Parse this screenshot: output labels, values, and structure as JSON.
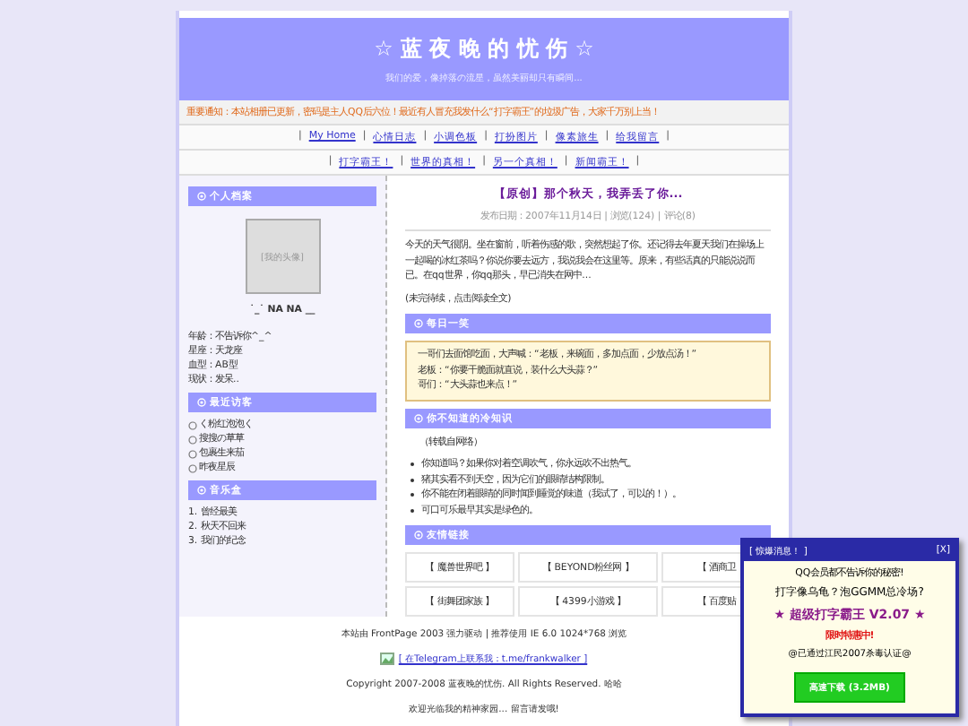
{
  "header": {
    "title": "☆ 蓝 夜 晚 的 忧 伤 ☆",
    "subtitle": "我们的爱，像掉落の流星，虽然美丽却只有瞬间..."
  },
  "notice": "重要通知：本站相册已更新，密码是主人QQ后六位！最近有人冒充我发什么“打字霸王”的垃圾广告，大家千万别上当！",
  "nav_separator": "|",
  "nav_rows": [
    [
      "My Home",
      "心情日志",
      "小调色板",
      "打扮图片",
      "像素旅生",
      "给我留言"
    ],
    [
      "打字霸王！",
      "世界的真相！",
      "另一个真相！",
      "新闻霸王！"
    ]
  ],
  "sidebar": {
    "profile": {
      "heading": "个人档案",
      "avatar": "[我的头像]",
      "nickname": "˙_˙ NA NA __",
      "facts": [
        "年龄：不告诉你^_^",
        "星座：天龙座",
        "血型：AB型",
        "现状：发呆.."
      ]
    },
    "visitors": {
      "heading": "最近访客",
      "items": [
        "く粉红泡泡く",
        "搜搜の草草",
        "包裹生来茄",
        "昨夜星辰"
      ]
    },
    "music": {
      "heading": "音乐盒",
      "items": [
        "1. 曾经最美",
        "2. 秋天不回来",
        "3. 我们的纪念"
      ]
    }
  },
  "post": {
    "title": "【原创】那个秋天，我弄丢了你...",
    "meta": "发布日期：2007年11月14日 | 浏览(124) | 评论(8)",
    "body": "今天的天气很阴。坐在窗前，听着伤感的歌，突然想起了你。还记得去年夏天我们在操场上一起喝的冰红茶吗？你说你要去远方，我说我会在这里等。原来，有些话真的只能说说而已。在qq世界，你qq那头，早已消失在网中...",
    "more": "(未完待续，点击阅读全文)"
  },
  "joke": {
    "heading": "每日一笑",
    "lines": [
      "一哥们去面馆吃面，大声喊：“老板，来碗面，多加点面，少放点汤！”",
      "老板：“你要干脆面就直说，装什么大头蒜？”",
      "哥们：“大头蒜也来点！”"
    ]
  },
  "facts": {
    "heading": "你不知道的冷知识",
    "source": "（转载自网络）",
    "items": [
      "你知道吗？如果你对着空调吹气，你永远吹不出热气。",
      "猪其实看不到天空，因为它们的眼睛结构限制。",
      "你不能在闭着眼睛的同时闻到睡觉的味道（我试了，可以的！）。",
      "可口可乐最早其实是绿色的。"
    ]
  },
  "links": {
    "heading": "友情链接",
    "cells": [
      "【 魔兽世界吧 】",
      "【 BEYOND粉丝网 】",
      "【 酒商卫",
      "【 街舞团家族 】",
      "【 4399小游戏 】",
      "【 百度贴"
    ]
  },
  "footer": {
    "powered": "本站由 FrontPage 2003 强力驱动 | 推荐使用 IE 6.0 1024*768 浏览",
    "contact": "[ 在Telegram上联系我：t.me/frankwalker ]",
    "copyright": "Copyright 2007-2008 蓝夜晚的忧伤. All Rights Reserved. 哈哈",
    "welcome": "欢迎光临我的精神家园... 留言请发哦!"
  },
  "popup": {
    "title": "[ 惊爆消息！ ]",
    "close": "[X]",
    "lines": [
      "QQ会员都不告诉你的秘密!",
      "打字像乌龟？泡GGMM总冷场?"
    ],
    "product": "★ 超级打字霸王 V2.07 ★",
    "offer": "限时特惠中!",
    "cert": "@已通过江民2007杀毒认证@",
    "button": "高速下载 (3.2MB)"
  }
}
